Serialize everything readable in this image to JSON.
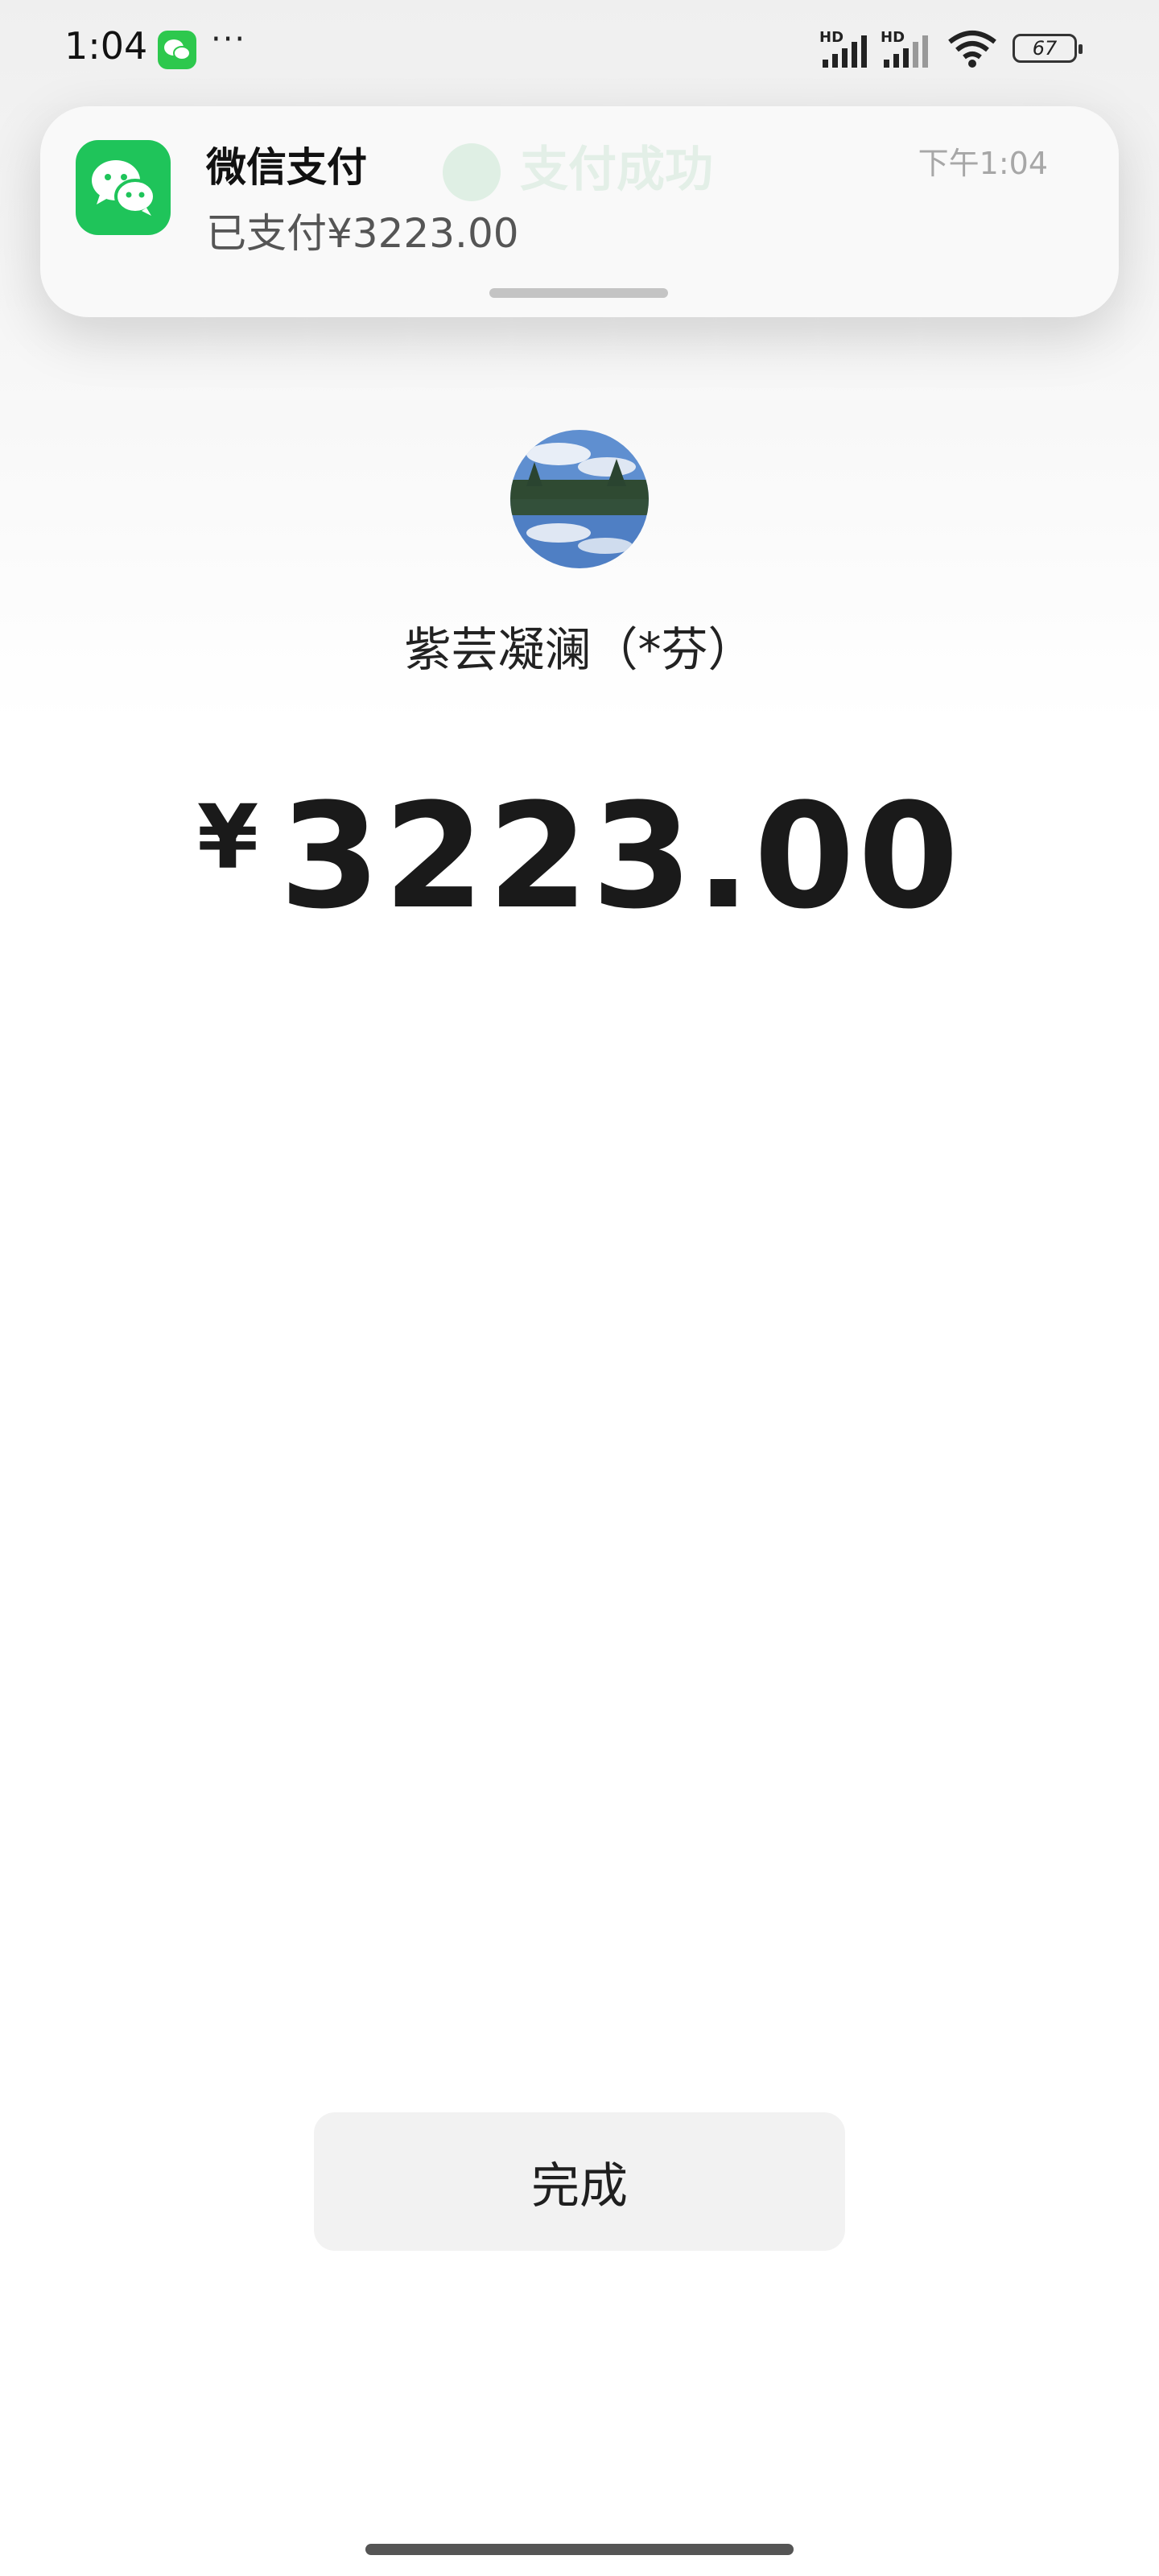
{
  "status_bar": {
    "time": "1:04",
    "more": "···",
    "signal_label_1": "HD",
    "signal_label_2": "HD",
    "battery": "67"
  },
  "notification": {
    "app_name": "微信支付",
    "message": "已支付¥3223.00",
    "time": "下午1:04",
    "background_text": "支付成功"
  },
  "payment": {
    "payee": "紫芸凝澜（*芬）",
    "currency_symbol": "¥",
    "amount": "3223.00"
  },
  "actions": {
    "done_label": "完成"
  },
  "colors": {
    "wechat_green": "#1fc45a",
    "button_bg": "#f2f2f2"
  }
}
